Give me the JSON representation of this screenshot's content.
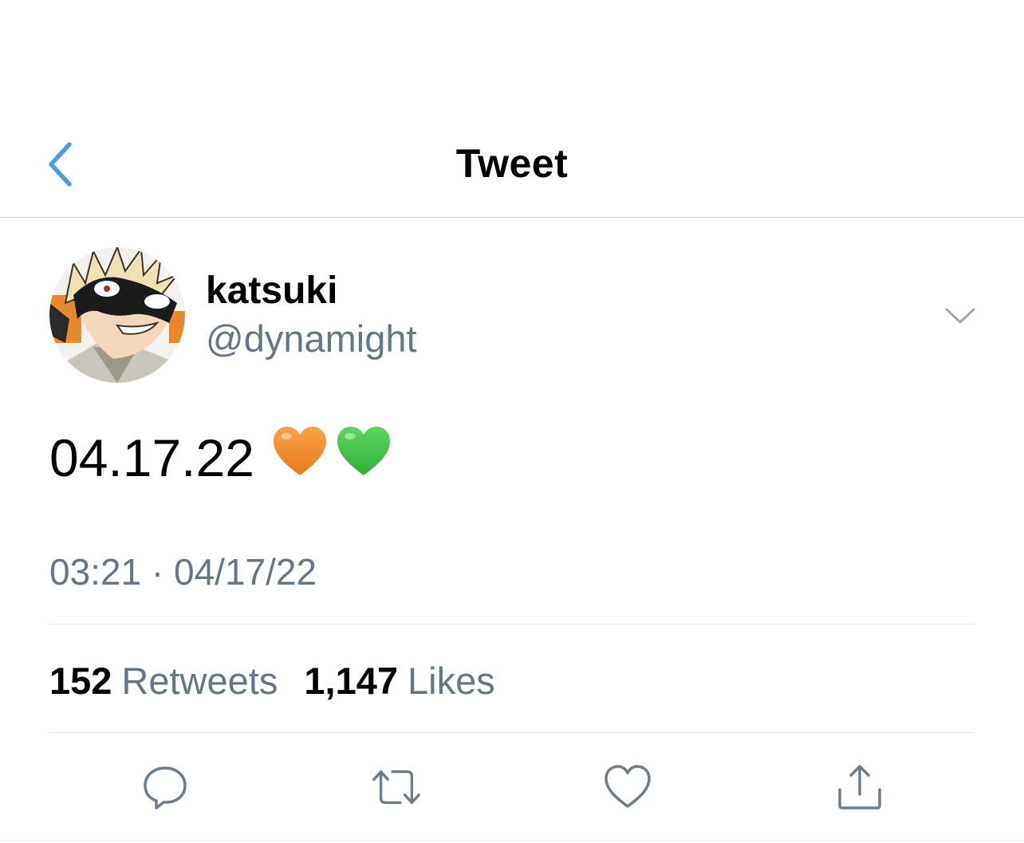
{
  "nav": {
    "title": "Tweet",
    "back_icon": "chevron-left-icon",
    "accent_color": "#4a9bea"
  },
  "author": {
    "display_name": "katsuki",
    "handle": "@dynamight",
    "avatar": "avatar-image",
    "more_icon": "chevron-down-icon"
  },
  "tweet": {
    "text": "04.17.22",
    "emojis": [
      "orange-heart",
      "green-heart"
    ],
    "timestamp": "03:21 · 04/17/22"
  },
  "stats": {
    "retweets_count": "152",
    "retweets_label": "Retweets",
    "likes_count": "1,147",
    "likes_label": "Likes"
  },
  "actions": [
    {
      "icon": "reply-icon"
    },
    {
      "icon": "retweet-icon"
    },
    {
      "icon": "like-icon"
    },
    {
      "icon": "share-icon"
    }
  ],
  "colors": {
    "secondary_text": "#657786",
    "orange_heart": "#f0892a",
    "green_heart": "#44c24a"
  }
}
